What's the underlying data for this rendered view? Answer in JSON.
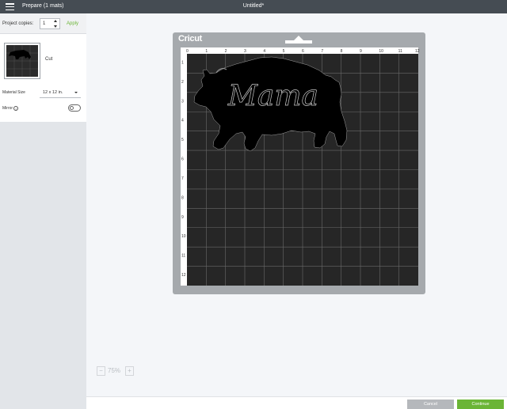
{
  "topbar": {
    "left_title": "Prepare (1 mats)",
    "center_title": "Untitled*"
  },
  "sidebar": {
    "copies_label": "Project copies:",
    "copies_value": "1",
    "apply_label": "Apply",
    "mat_label": "Cut",
    "size_label": "Material Size",
    "size_value": "12 x 12 in.",
    "mirror_label": "Mirror",
    "mirror_on": false
  },
  "mat": {
    "brand": "Cricut",
    "top_ruler": [
      "0",
      "1",
      "2",
      "3",
      "4",
      "5",
      "6",
      "7",
      "8",
      "9",
      "10",
      "11",
      "12"
    ],
    "side_ruler": [
      "1",
      "2",
      "3",
      "4",
      "5",
      "6",
      "7",
      "8",
      "9",
      "10",
      "11",
      "12"
    ],
    "design_text": "Mama"
  },
  "zoom": {
    "minus": "−",
    "value": "75%",
    "plus": "+"
  },
  "footer": {
    "cancel_label": "Cancel",
    "continue_label": "Continue"
  },
  "colors": {
    "topbar": "#454c53",
    "mat_frame": "#a5a9ad",
    "mat_surface": "#262626",
    "accent": "#6bb536"
  }
}
